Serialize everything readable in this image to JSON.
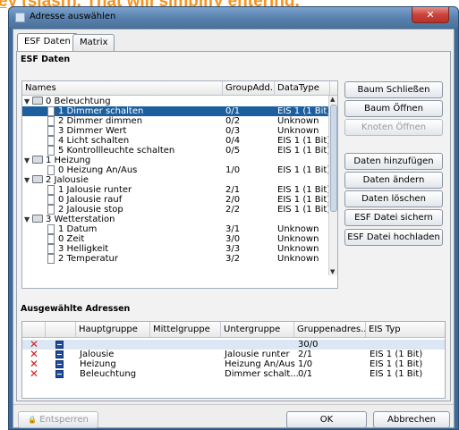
{
  "banner_text": "ey (slash). That will simplify entering.",
  "window": {
    "title": "Adresse auswählen",
    "close_glyph": "✕"
  },
  "tabs": [
    {
      "label": "ESF Daten"
    },
    {
      "label": "Matrix"
    }
  ],
  "esf": {
    "section_title": "ESF Daten",
    "columns": [
      "Names",
      "GroupAdd...",
      "DataType"
    ],
    "rows": [
      {
        "kind": "folder",
        "name": "0 Beleuchtung",
        "group": "",
        "type": ""
      },
      {
        "kind": "item",
        "name": "1 Dimmer schalten",
        "group": "0/1",
        "type": "EIS 1 (1 Bit)",
        "selected": true
      },
      {
        "kind": "item",
        "name": "2 Dimmer dimmen",
        "group": "0/2",
        "type": "Unknown"
      },
      {
        "kind": "item",
        "name": "3 Dimmer Wert",
        "group": "0/3",
        "type": "Unknown"
      },
      {
        "kind": "item",
        "name": "4 Licht schalten",
        "group": "0/4",
        "type": "EIS 1 (1 Bit)"
      },
      {
        "kind": "item",
        "name": "5 Kontrollleuchte schalten",
        "group": "0/5",
        "type": "EIS 1 (1 Bit)"
      },
      {
        "kind": "folder",
        "name": "1 Heizung",
        "group": "",
        "type": ""
      },
      {
        "kind": "item",
        "name": "0 Heizung An/Aus",
        "group": "1/0",
        "type": "EIS 1 (1 Bit)"
      },
      {
        "kind": "folder",
        "name": "2 Jalousie",
        "group": "",
        "type": ""
      },
      {
        "kind": "item",
        "name": "1 Jalousie runter",
        "group": "2/1",
        "type": "EIS 1 (1 Bit)"
      },
      {
        "kind": "item",
        "name": "0 Jalousie rauf",
        "group": "2/0",
        "type": "EIS 1 (1 Bit)"
      },
      {
        "kind": "item",
        "name": "2 Jalousie stop",
        "group": "2/2",
        "type": "EIS 1 (1 Bit)"
      },
      {
        "kind": "folder",
        "name": "3 Wetterstation",
        "group": "",
        "type": ""
      },
      {
        "kind": "item",
        "name": "1 Datum",
        "group": "3/1",
        "type": "Unknown"
      },
      {
        "kind": "item",
        "name": "0 Zeit",
        "group": "3/0",
        "type": "Unknown"
      },
      {
        "kind": "item",
        "name": "3 Helligkeit",
        "group": "3/3",
        "type": "Unknown"
      },
      {
        "kind": "item",
        "name": "2 Temperatur",
        "group": "3/2",
        "type": "Unknown"
      }
    ],
    "buttons": [
      {
        "label": "Baum Schließen",
        "enabled": true
      },
      {
        "label": "Baum Öffnen",
        "enabled": true
      },
      {
        "label": "Knoten Öffnen",
        "enabled": false
      },
      {
        "label": "Daten hinzufügen",
        "enabled": true
      },
      {
        "label": "Daten ändern",
        "enabled": true
      },
      {
        "label": "Daten löschen",
        "enabled": true
      },
      {
        "label": "ESF Datei sichern",
        "enabled": true
      },
      {
        "label": "ESF Datei hochladen",
        "enabled": true
      }
    ]
  },
  "selected": {
    "section_title": "Ausgewählte Adressen",
    "columns": [
      "",
      "",
      "Hauptgruppe",
      "Mittelgruppe",
      "Untergruppe",
      "Gruppenadres...",
      "EIS Typ"
    ],
    "rows": [
      {
        "haupt": "",
        "mittel": "",
        "unter": "",
        "adresse": "30/0",
        "typ": "",
        "highlight": true
      },
      {
        "haupt": "Jalousie",
        "mittel": "",
        "unter": "Jalousie runter",
        "adresse": "2/1",
        "typ": "EIS 1 (1 Bit)"
      },
      {
        "haupt": "Heizung",
        "mittel": "",
        "unter": "Heizung An/Aus",
        "adresse": "1/0",
        "typ": "EIS 1 (1 Bit)"
      },
      {
        "haupt": "Beleuchtung",
        "mittel": "",
        "unter": "Dimmer schalt...",
        "adresse": "0/1",
        "typ": "EIS 1 (1 Bit)"
      }
    ],
    "remove_glyph": "✕"
  },
  "footer": {
    "unlock_label": "Entsperren",
    "ok_label": "OK",
    "cancel_label": "Abbrechen",
    "lock_glyph": "🔒"
  }
}
